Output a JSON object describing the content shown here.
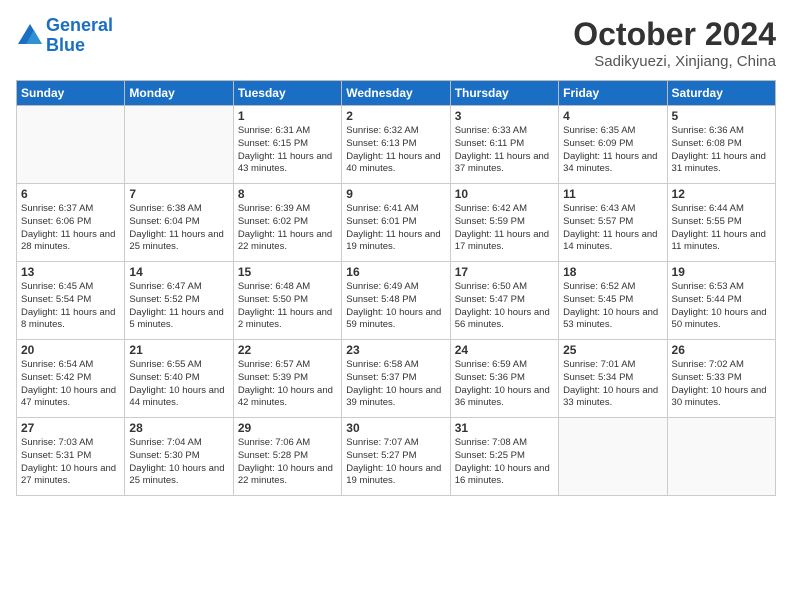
{
  "logo": {
    "text_general": "General",
    "text_blue": "Blue"
  },
  "header": {
    "month": "October 2024",
    "location": "Sadikyuezi, Xinjiang, China"
  },
  "weekdays": [
    "Sunday",
    "Monday",
    "Tuesday",
    "Wednesday",
    "Thursday",
    "Friday",
    "Saturday"
  ],
  "weeks": [
    [
      {
        "day": "",
        "info": ""
      },
      {
        "day": "",
        "info": ""
      },
      {
        "day": "1",
        "info": "Sunrise: 6:31 AM\nSunset: 6:15 PM\nDaylight: 11 hours and 43 minutes."
      },
      {
        "day": "2",
        "info": "Sunrise: 6:32 AM\nSunset: 6:13 PM\nDaylight: 11 hours and 40 minutes."
      },
      {
        "day": "3",
        "info": "Sunrise: 6:33 AM\nSunset: 6:11 PM\nDaylight: 11 hours and 37 minutes."
      },
      {
        "day": "4",
        "info": "Sunrise: 6:35 AM\nSunset: 6:09 PM\nDaylight: 11 hours and 34 minutes."
      },
      {
        "day": "5",
        "info": "Sunrise: 6:36 AM\nSunset: 6:08 PM\nDaylight: 11 hours and 31 minutes."
      }
    ],
    [
      {
        "day": "6",
        "info": "Sunrise: 6:37 AM\nSunset: 6:06 PM\nDaylight: 11 hours and 28 minutes."
      },
      {
        "day": "7",
        "info": "Sunrise: 6:38 AM\nSunset: 6:04 PM\nDaylight: 11 hours and 25 minutes."
      },
      {
        "day": "8",
        "info": "Sunrise: 6:39 AM\nSunset: 6:02 PM\nDaylight: 11 hours and 22 minutes."
      },
      {
        "day": "9",
        "info": "Sunrise: 6:41 AM\nSunset: 6:01 PM\nDaylight: 11 hours and 19 minutes."
      },
      {
        "day": "10",
        "info": "Sunrise: 6:42 AM\nSunset: 5:59 PM\nDaylight: 11 hours and 17 minutes."
      },
      {
        "day": "11",
        "info": "Sunrise: 6:43 AM\nSunset: 5:57 PM\nDaylight: 11 hours and 14 minutes."
      },
      {
        "day": "12",
        "info": "Sunrise: 6:44 AM\nSunset: 5:55 PM\nDaylight: 11 hours and 11 minutes."
      }
    ],
    [
      {
        "day": "13",
        "info": "Sunrise: 6:45 AM\nSunset: 5:54 PM\nDaylight: 11 hours and 8 minutes."
      },
      {
        "day": "14",
        "info": "Sunrise: 6:47 AM\nSunset: 5:52 PM\nDaylight: 11 hours and 5 minutes."
      },
      {
        "day": "15",
        "info": "Sunrise: 6:48 AM\nSunset: 5:50 PM\nDaylight: 11 hours and 2 minutes."
      },
      {
        "day": "16",
        "info": "Sunrise: 6:49 AM\nSunset: 5:48 PM\nDaylight: 10 hours and 59 minutes."
      },
      {
        "day": "17",
        "info": "Sunrise: 6:50 AM\nSunset: 5:47 PM\nDaylight: 10 hours and 56 minutes."
      },
      {
        "day": "18",
        "info": "Sunrise: 6:52 AM\nSunset: 5:45 PM\nDaylight: 10 hours and 53 minutes."
      },
      {
        "day": "19",
        "info": "Sunrise: 6:53 AM\nSunset: 5:44 PM\nDaylight: 10 hours and 50 minutes."
      }
    ],
    [
      {
        "day": "20",
        "info": "Sunrise: 6:54 AM\nSunset: 5:42 PM\nDaylight: 10 hours and 47 minutes."
      },
      {
        "day": "21",
        "info": "Sunrise: 6:55 AM\nSunset: 5:40 PM\nDaylight: 10 hours and 44 minutes."
      },
      {
        "day": "22",
        "info": "Sunrise: 6:57 AM\nSunset: 5:39 PM\nDaylight: 10 hours and 42 minutes."
      },
      {
        "day": "23",
        "info": "Sunrise: 6:58 AM\nSunset: 5:37 PM\nDaylight: 10 hours and 39 minutes."
      },
      {
        "day": "24",
        "info": "Sunrise: 6:59 AM\nSunset: 5:36 PM\nDaylight: 10 hours and 36 minutes."
      },
      {
        "day": "25",
        "info": "Sunrise: 7:01 AM\nSunset: 5:34 PM\nDaylight: 10 hours and 33 minutes."
      },
      {
        "day": "26",
        "info": "Sunrise: 7:02 AM\nSunset: 5:33 PM\nDaylight: 10 hours and 30 minutes."
      }
    ],
    [
      {
        "day": "27",
        "info": "Sunrise: 7:03 AM\nSunset: 5:31 PM\nDaylight: 10 hours and 27 minutes."
      },
      {
        "day": "28",
        "info": "Sunrise: 7:04 AM\nSunset: 5:30 PM\nDaylight: 10 hours and 25 minutes."
      },
      {
        "day": "29",
        "info": "Sunrise: 7:06 AM\nSunset: 5:28 PM\nDaylight: 10 hours and 22 minutes."
      },
      {
        "day": "30",
        "info": "Sunrise: 7:07 AM\nSunset: 5:27 PM\nDaylight: 10 hours and 19 minutes."
      },
      {
        "day": "31",
        "info": "Sunrise: 7:08 AM\nSunset: 5:25 PM\nDaylight: 10 hours and 16 minutes."
      },
      {
        "day": "",
        "info": ""
      },
      {
        "day": "",
        "info": ""
      }
    ]
  ]
}
